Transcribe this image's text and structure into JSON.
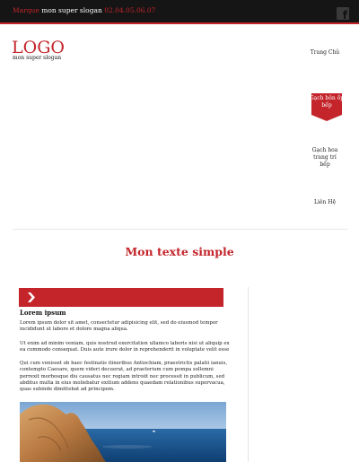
{
  "topbar": {
    "brand": "Marque",
    "slogan": "mon super slogan",
    "phone": "02.04.05.06.07",
    "social_icon": "facebook-icon"
  },
  "header": {
    "logo": "LOGO",
    "logo_slogan": "mon super slogan"
  },
  "nav": {
    "items": [
      {
        "label": "Trang Chủ",
        "active": false
      },
      {
        "label": "Gạch bôn ốp bếp",
        "active": true
      },
      {
        "label": "Gạch hoa trang trí bếp",
        "active": false
      },
      {
        "label": "Liên Hệ",
        "active": false
      }
    ]
  },
  "main": {
    "section_title": "Mon texte simple",
    "banner_icon": "chevron-right-icon",
    "article": {
      "heading": "Lorem ipsum",
      "p1": "Lorem ipsum dolor sit amet, consectetur adipisicing elit, sed do eiusmod tempor incididunt ut labore et dolore magna aliqua.",
      "p2": "Ut enim ad minim veniam, quis nostrud exercitation ullamco laboris nisi ut aliquip ex ea commodo consequat. Duis aute irure dolor in reprehenderit in voluptate velit esse",
      "p3": "Qui cum venisset ob haec festinatis itineribus Antiochiam, praestrictis palatii ianuis, contempto Caesare, quem videri decuerat, ad praetorium cum pompa sollemni perrexit morbosque diu causatus nec regiam introiit nec processit in publicum, sed abditus multa in eius moliebatur exitium addens quaedam relationibus supervacua, quas subinde dimittebat ad principem.",
      "image_alt": "coastal-rock-photo"
    }
  },
  "colors": {
    "accent": "#c3252b",
    "topbar_bg": "#151515"
  }
}
